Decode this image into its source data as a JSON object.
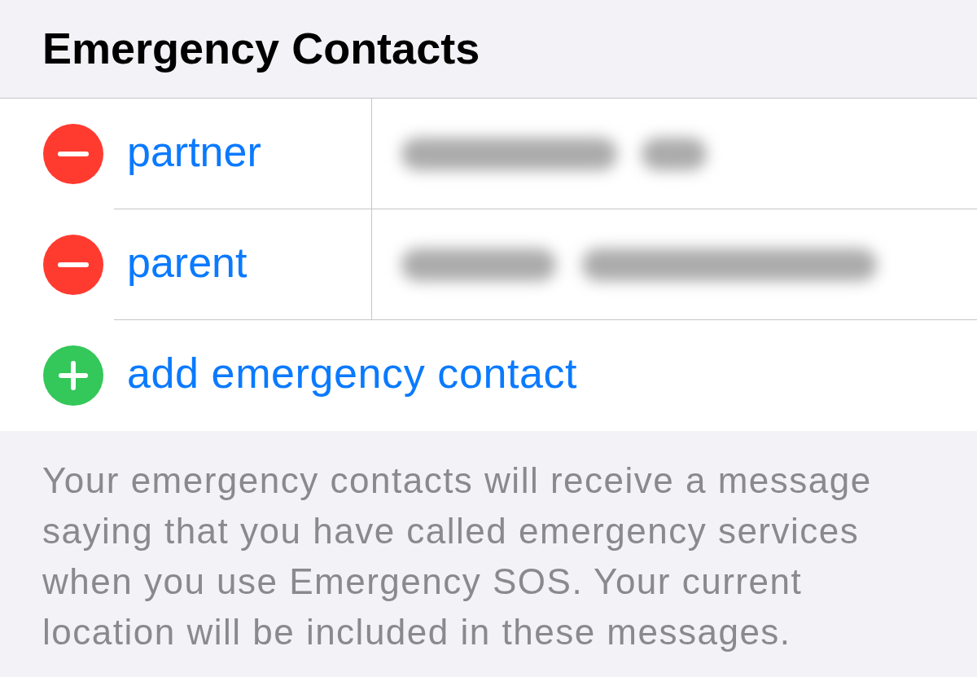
{
  "title": "Emergency Contacts",
  "contacts": [
    {
      "relationship": "partner",
      "redacted": true
    },
    {
      "relationship": "parent",
      "redacted": true
    }
  ],
  "add_action": {
    "label": "add emergency contact"
  },
  "footer": "Your emergency contacts will receive a message saying that you have called emergency services when you use Emergency SOS. Your current location will be included in these messages."
}
